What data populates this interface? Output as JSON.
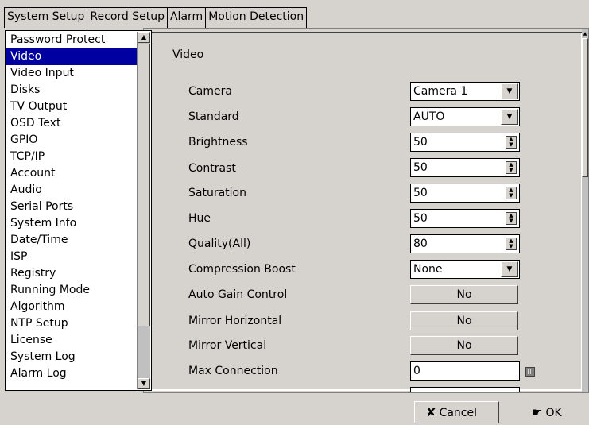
{
  "tabs": [
    {
      "label": "System Setup"
    },
    {
      "label": "Record Setup"
    },
    {
      "label": "Alarm"
    },
    {
      "label": "Motion Detection"
    }
  ],
  "sidebar": {
    "items": [
      {
        "label": "Password Protect"
      },
      {
        "label": "Video"
      },
      {
        "label": "Video Input"
      },
      {
        "label": "Disks"
      },
      {
        "label": "TV Output"
      },
      {
        "label": "OSD Text"
      },
      {
        "label": "GPIO"
      },
      {
        "label": "TCP/IP"
      },
      {
        "label": "Account"
      },
      {
        "label": "Audio"
      },
      {
        "label": "Serial Ports"
      },
      {
        "label": "System Info"
      },
      {
        "label": "Date/Time"
      },
      {
        "label": "ISP"
      },
      {
        "label": "Registry"
      },
      {
        "label": "Running Mode"
      },
      {
        "label": "Algorithm"
      },
      {
        "label": "NTP Setup"
      },
      {
        "label": "License"
      },
      {
        "label": "System Log"
      },
      {
        "label": "Alarm Log"
      }
    ],
    "selected": "Video"
  },
  "panel": {
    "title": "Video",
    "fields": {
      "camera": {
        "label": "Camera",
        "value": "Camera 1"
      },
      "standard": {
        "label": "Standard",
        "value": "AUTO"
      },
      "brightness": {
        "label": "Brightness",
        "value": "50"
      },
      "contrast": {
        "label": "Contrast",
        "value": "50"
      },
      "saturation": {
        "label": "Saturation",
        "value": "50"
      },
      "hue": {
        "label": "Hue",
        "value": "50"
      },
      "quality": {
        "label": "Quality(All)",
        "value": "80"
      },
      "compression_boost": {
        "label": "Compression Boost",
        "value": "None"
      },
      "auto_gain": {
        "label": "Auto Gain Control",
        "value": "No"
      },
      "mirror_h": {
        "label": "Mirror Horizontal",
        "value": "No"
      },
      "mirror_v": {
        "label": "Mirror Vertical",
        "value": "No"
      },
      "max_connection": {
        "label": "Max Connection",
        "value": "0"
      }
    }
  },
  "footer": {
    "cancel": {
      "label": "Cancel",
      "icon": "x-icon"
    },
    "ok": {
      "label": "OK",
      "icon": "hand-check-icon"
    }
  }
}
